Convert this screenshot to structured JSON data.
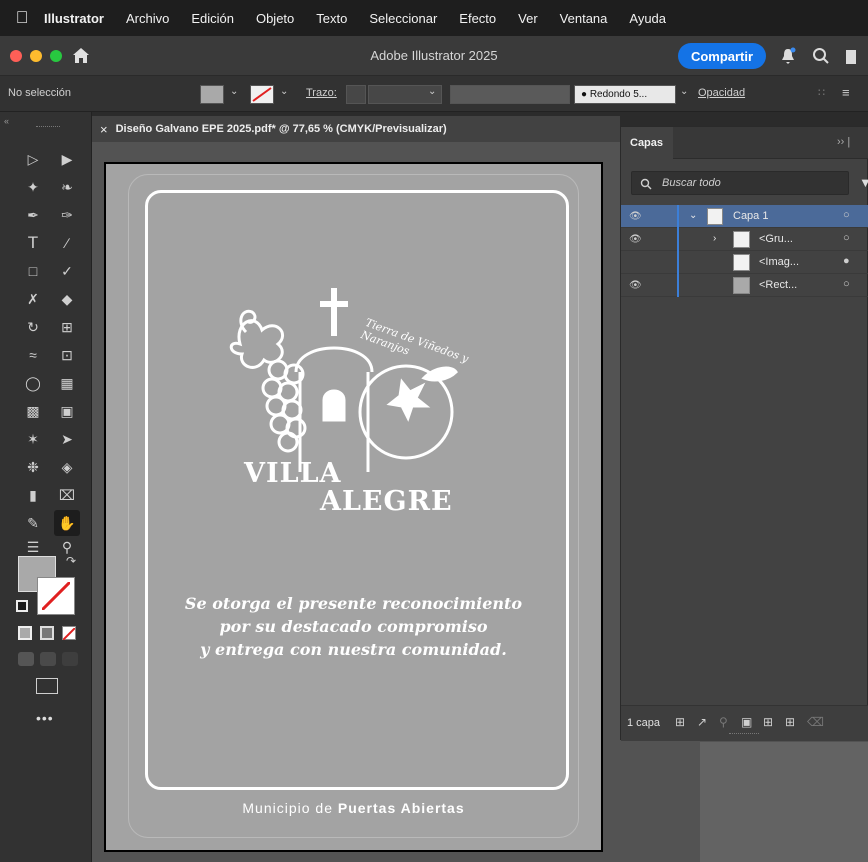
{
  "menubar": {
    "app_name": "Illustrator",
    "items": [
      "Archivo",
      "Edición",
      "Objeto",
      "Texto",
      "Seleccionar",
      "Efecto",
      "Ver",
      "Ventana",
      "Ayuda"
    ]
  },
  "titlebar": {
    "title": "Adobe Illustrator 2025",
    "share_label": "Compartir"
  },
  "controlbar": {
    "selection_status": "No selección",
    "stroke_label": "Trazo:",
    "brush_label": "Redondo 5...",
    "opacity_label": "Opacidad"
  },
  "document": {
    "tab_title": "Diseño Galvano EPE 2025.pdf* @ 77,65 % (CMYK/Previsualizar)",
    "close_glyph": "×"
  },
  "artwork": {
    "logo_line1": "VILLA",
    "logo_line2": "ALEGRE",
    "tagline": "Tierra de Viñedos y Naranjos",
    "message_line1": "Se otorga el presente reconocimiento",
    "message_line2": "por su destacado compromiso",
    "message_line3": "y entrega con nuestra comunidad.",
    "footer_regular": "Municipio de ",
    "footer_bold": "Puertas Abiertas"
  },
  "layers_panel": {
    "title": "Capas",
    "search_placeholder": "Buscar todo",
    "layers": [
      {
        "name": "Capa 1",
        "visible": true,
        "expanded": true
      },
      {
        "name": "<Gru...",
        "visible": true
      },
      {
        "name": "<Imag...",
        "visible": false
      },
      {
        "name": "<Rect...",
        "visible": true
      }
    ],
    "footer_count": "1 capa"
  },
  "colors": {
    "accent_blue": "#1473e6",
    "close": "#ff5f57",
    "minimize": "#febc2e",
    "zoom": "#28c840",
    "artboard": "#a3a3a3"
  },
  "icons": [
    "apple-icon",
    "home-icon",
    "bell-icon",
    "search-icon",
    "filter-icon",
    "eye-icon"
  ]
}
